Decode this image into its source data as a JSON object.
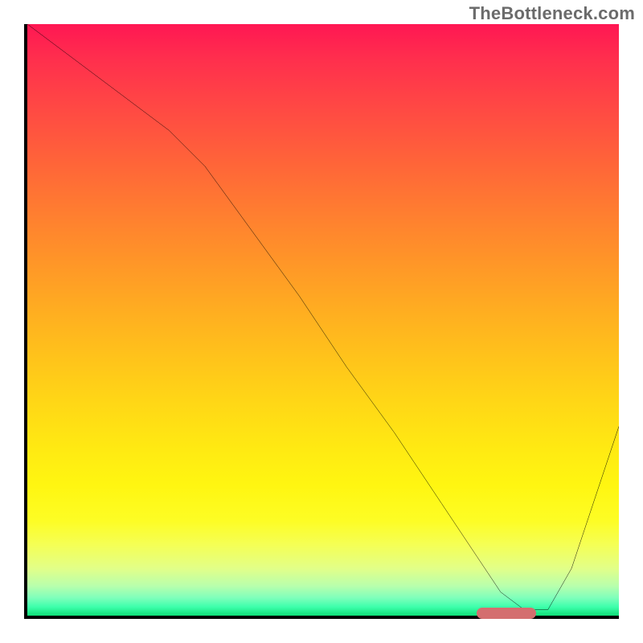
{
  "watermark": "TheBottleneck.com",
  "chart_data": {
    "type": "line",
    "title": "",
    "xlabel": "",
    "ylabel": "",
    "xlim": [
      0,
      100
    ],
    "ylim": [
      0,
      100
    ],
    "grid": false,
    "legend": false,
    "background_gradient": {
      "direction": "vertical",
      "stops": [
        {
          "pos": 0.0,
          "color": "#ff1753"
        },
        {
          "pos": 0.5,
          "color": "#ffb41f"
        },
        {
          "pos": 0.8,
          "color": "#fff611"
        },
        {
          "pos": 0.95,
          "color": "#b8ffad"
        },
        {
          "pos": 1.0,
          "color": "#0fde78"
        }
      ]
    },
    "series": [
      {
        "name": "curve",
        "color": "#000000",
        "x": [
          0,
          8,
          16,
          24,
          30,
          38,
          46,
          54,
          62,
          70,
          76,
          80,
          84,
          88,
          92,
          96,
          100
        ],
        "y": [
          100,
          94,
          88,
          82,
          76,
          65,
          54,
          42,
          31,
          19,
          10,
          4,
          1,
          1,
          8,
          20,
          32
        ]
      }
    ],
    "marker": {
      "name": "optimal-range",
      "color": "#d46e6f",
      "x_start": 76,
      "x_end": 86,
      "y": 0
    }
  }
}
